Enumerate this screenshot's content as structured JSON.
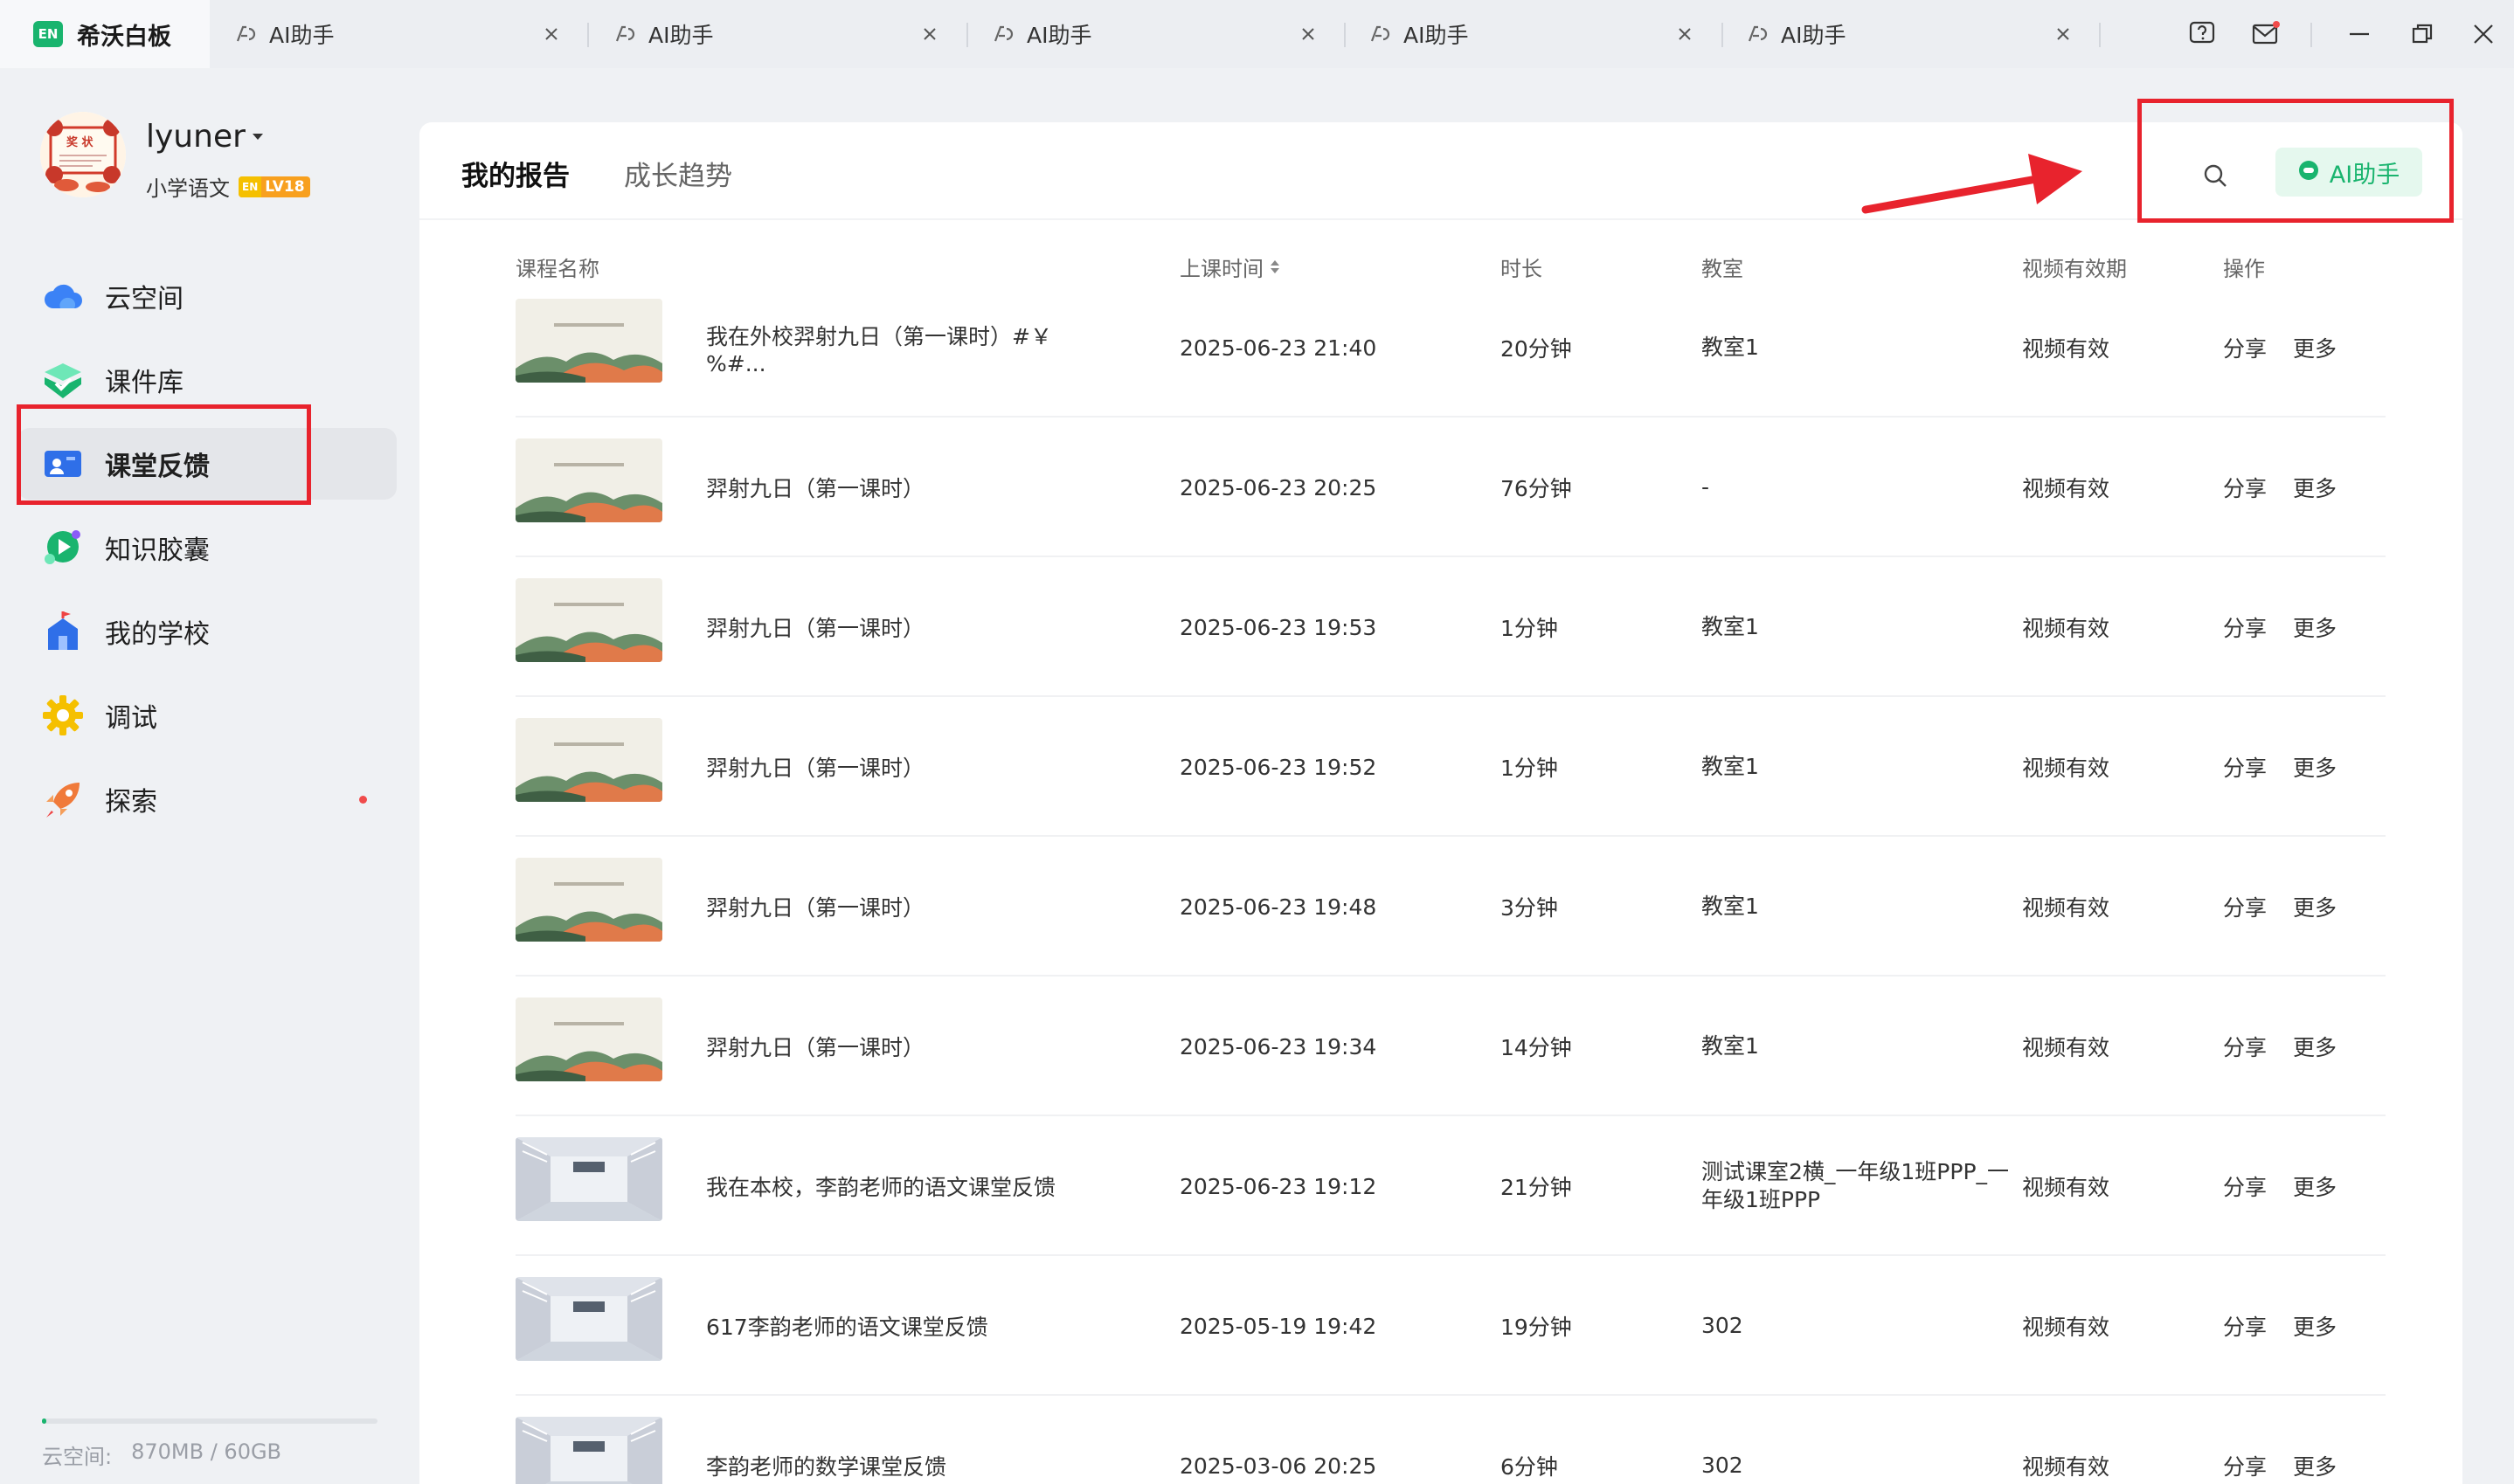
{
  "app": {
    "badge": "EN",
    "name": "希沃白板"
  },
  "tabs": [
    {
      "label": "AI助手"
    },
    {
      "label": "AI助手"
    },
    {
      "label": "AI助手"
    },
    {
      "label": "AI助手"
    },
    {
      "label": "AI助手"
    }
  ],
  "user": {
    "name": "lyuner",
    "subject": "小学语文",
    "level_en": "EN",
    "level": "LV18",
    "avatar_text": "奖 状"
  },
  "sidebar": {
    "items": [
      {
        "label": "云空间",
        "icon": "cloud-icon"
      },
      {
        "label": "课件库",
        "icon": "courseware-library-icon"
      },
      {
        "label": "课堂反馈",
        "icon": "classroom-feedback-icon",
        "active": true
      },
      {
        "label": "知识胶囊",
        "icon": "knowledge-capsule-icon"
      },
      {
        "label": "我的学校",
        "icon": "school-icon"
      },
      {
        "label": "调试",
        "icon": "debug-gear-icon"
      },
      {
        "label": "探索",
        "icon": "rocket-icon",
        "dot": true
      }
    ],
    "storage": {
      "label": "云空间:",
      "value": "870MB / 60GB",
      "fraction": 0.014
    }
  },
  "main": {
    "tabs": [
      {
        "label": "我的报告",
        "active": true
      },
      {
        "label": "成长趋势"
      }
    ],
    "ai_button": "AI助手",
    "columns": {
      "course": "课程名称",
      "time": "上课时间",
      "duration": "时长",
      "room": "教室",
      "validity": "视频有效期",
      "ops": "操作"
    },
    "rows": [
      {
        "name": "我在外校羿射九日（第一课时）#￥%#...",
        "time": "2025-06-23 21:40",
        "duration": "20分钟",
        "room": "教室1",
        "validity": "视频有效",
        "share": "分享",
        "more": "更多",
        "thumb": "slide"
      },
      {
        "name": "羿射九日（第一课时）",
        "time": "2025-06-23 20:25",
        "duration": "76分钟",
        "room": "-",
        "validity": "视频有效",
        "share": "分享",
        "more": "更多",
        "thumb": "slide"
      },
      {
        "name": "羿射九日（第一课时）",
        "time": "2025-06-23 19:53",
        "duration": "1分钟",
        "room": "教室1",
        "validity": "视频有效",
        "share": "分享",
        "more": "更多",
        "thumb": "slide"
      },
      {
        "name": "羿射九日（第一课时）",
        "time": "2025-06-23 19:52",
        "duration": "1分钟",
        "room": "教室1",
        "validity": "视频有效",
        "share": "分享",
        "more": "更多",
        "thumb": "slide"
      },
      {
        "name": "羿射九日（第一课时）",
        "time": "2025-06-23 19:48",
        "duration": "3分钟",
        "room": "教室1",
        "validity": "视频有效",
        "share": "分享",
        "more": "更多",
        "thumb": "slide"
      },
      {
        "name": "羿射九日（第一课时）",
        "time": "2025-06-23 19:34",
        "duration": "14分钟",
        "room": "教室1",
        "validity": "视频有效",
        "share": "分享",
        "more": "更多",
        "thumb": "slide"
      },
      {
        "name": "我在本校，李韵老师的语文课堂反馈",
        "time": "2025-06-23 19:12",
        "duration": "21分钟",
        "room": "测试课室2横_一年级1班PPP_一年级1班PPP",
        "validity": "视频有效",
        "share": "分享",
        "more": "更多",
        "thumb": "classroom"
      },
      {
        "name": "617李韵老师的语文课堂反馈",
        "time": "2025-05-19 19:42",
        "duration": "19分钟",
        "room": "302",
        "validity": "视频有效",
        "share": "分享",
        "more": "更多",
        "thumb": "classroom"
      },
      {
        "name": "李韵老师的数学课堂反馈",
        "time": "2025-03-06 20:25",
        "duration": "6分钟",
        "room": "302",
        "validity": "视频有效",
        "share": "分享",
        "more": "更多",
        "thumb": "classroom"
      }
    ]
  },
  "colors": {
    "accent": "#19b46e",
    "highlight": "#e8232d",
    "page_bg": "#eff1f4"
  }
}
